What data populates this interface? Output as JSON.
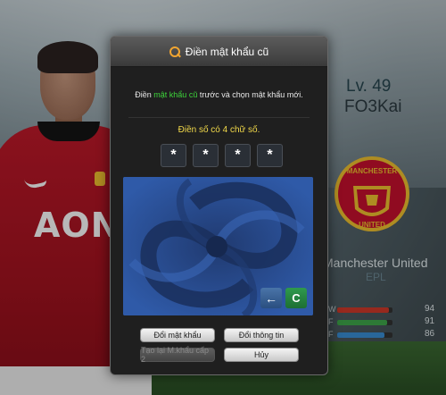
{
  "dialog": {
    "title": "Điền mật khẩu cũ",
    "instruction_pre": "Điền ",
    "instruction_highlight": "mật khẩu cũ",
    "instruction_post": " trước và chọn mật khẩu mới.",
    "hint": "Điền số có 4 chữ số.",
    "pin_chars": [
      "*",
      "*",
      "*",
      "*"
    ],
    "keypad": {
      "back_label": "←",
      "clear_label": "C"
    },
    "buttons": {
      "change_password": "Đổi mật khẩu",
      "change_info": "Đổi thông tin",
      "recreate_password": "Tạo lại M.khẩu cấp 2",
      "cancel": "Hủy"
    }
  },
  "profile": {
    "level": "Lv. 49",
    "nickname": "FO3Kai",
    "club": "Manchester United",
    "league": "EPL",
    "stats": [
      {
        "label": "W",
        "value": "94",
        "fill": 0.94,
        "color": "#d23a2a"
      },
      {
        "label": "F",
        "value": "91",
        "fill": 0.91,
        "color": "#3fa84b"
      },
      {
        "label": "F",
        "value": "86",
        "fill": 0.86,
        "color": "#3a8fd6"
      }
    ],
    "crest_text": {
      "top": "MANCHESTER",
      "bottom": "UNITED"
    }
  },
  "player": {
    "sponsor": "AON"
  },
  "colors": {
    "accent_orange": "#f1a531",
    "highlight_green": "#3dd43a",
    "hint_yellow": "#f2d94a",
    "keypad_blue": "#2a4a8a"
  }
}
